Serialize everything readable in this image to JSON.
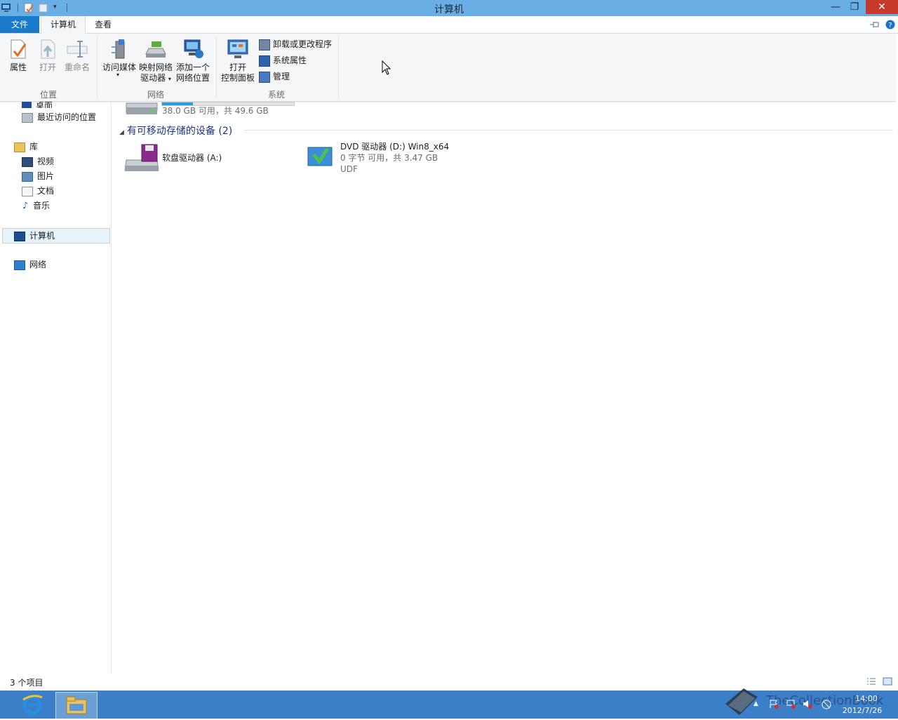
{
  "window": {
    "title": "计算机"
  },
  "tabs": {
    "file": "文件",
    "computer": "计算机",
    "view": "查看"
  },
  "ribbon": {
    "location": {
      "label": "位置",
      "properties": "属性",
      "open": "打开",
      "rename": "重命名"
    },
    "network": {
      "label": "网络",
      "access_media": "访问媒体",
      "map_drive_l1": "映射网络",
      "map_drive_l2": "驱动器",
      "add_location_l1": "添加一个",
      "add_location_l2": "网络位置"
    },
    "system": {
      "label": "系统",
      "open_cp_l1": "打开",
      "open_cp_l2": "控制面板",
      "uninstall": "卸载或更改程序",
      "sys_props": "系统属性",
      "manage": "管理"
    }
  },
  "nav": {
    "desktop": "桌面",
    "recent": "最近访问的位置",
    "libraries": "库",
    "videos": "视频",
    "pictures": "图片",
    "documents": "文档",
    "music": "音乐",
    "computer": "计算机",
    "network": "网络"
  },
  "content": {
    "c_drive": {
      "space": "38.0 GB 可用，共 49.6 GB",
      "used_fraction": 0.234
    },
    "removable_header": "有可移动存储的设备 (2)",
    "floppy": {
      "name": "软盘驱动器 (A:)"
    },
    "dvd": {
      "name": "DVD 驱动器 (D:) Win8_x64",
      "space": "0 字节 可用，共 3.47 GB",
      "fs": "UDF"
    }
  },
  "status": {
    "items": "3 个项目"
  },
  "taskbar": {
    "time": "14:00",
    "date": "2012/7/26"
  },
  "watermark": "TheCollectionBook",
  "colors": {
    "titlebar": "#6aaee6",
    "file_tab": "#1979ca",
    "taskbar": "#3a7fc8",
    "close": "#c7392b",
    "accent_text": "#1e3287"
  }
}
